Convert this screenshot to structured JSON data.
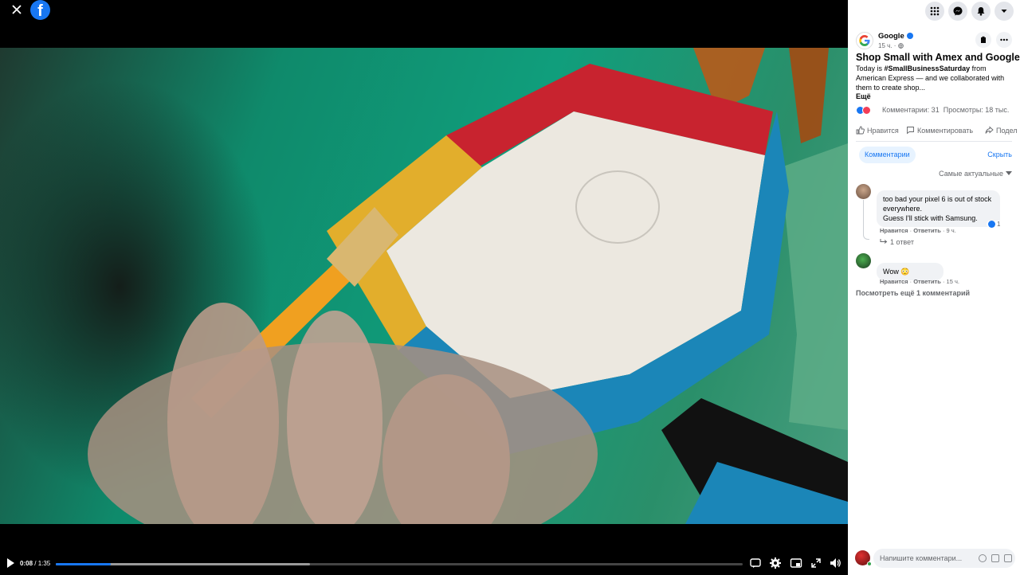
{
  "app": {
    "logo_letter": "f"
  },
  "video": {
    "current_time": "0:08",
    "duration": "1:35",
    "time_separator": " / ",
    "played_fraction": 0.08,
    "buffered_fraction": 0.37
  },
  "post": {
    "author": "Google",
    "time": "15 ч. · ",
    "title": "Shop Small with Amex and Google",
    "text_before_tag": "Today is ",
    "hashtag": "#SmallBusinessSaturday",
    "text_after_tag": " from American Express — and we collaborated with them to create shop...",
    "more_label": "Ещё",
    "comments_count": "Комментарии: 31",
    "views_count": "Просмотры: 18 тыс.",
    "like_label": "Нравится",
    "comment_label": "Комментировать",
    "share_label": "Подел"
  },
  "comments_section": {
    "tab_label": "Комментарии",
    "hide_label": "Скрыть",
    "sort_label": "Самые актуальные",
    "see_more_label": "Посмотреть ещё 1 комментарий",
    "items": [
      {
        "text_line1": "too bad your pixel 6 is out of stock",
        "text_line2": "everywhere.",
        "text_line3": "Guess I'll stick with Samsung.",
        "like_label": "Нравится",
        "reply_label": "Ответить",
        "time": "9 ч.",
        "like_count": "1",
        "replies_label": "1 ответ"
      },
      {
        "text": "Wow 😳",
        "like_label": "Нравится",
        "reply_label": "Ответить",
        "time": "15 ч."
      }
    ]
  },
  "composer": {
    "placeholder": "Напишите комментари..."
  },
  "colors": {
    "accent": "#1877f2",
    "sidebar_bg": "#ffffff",
    "video_bg": "#000000"
  }
}
